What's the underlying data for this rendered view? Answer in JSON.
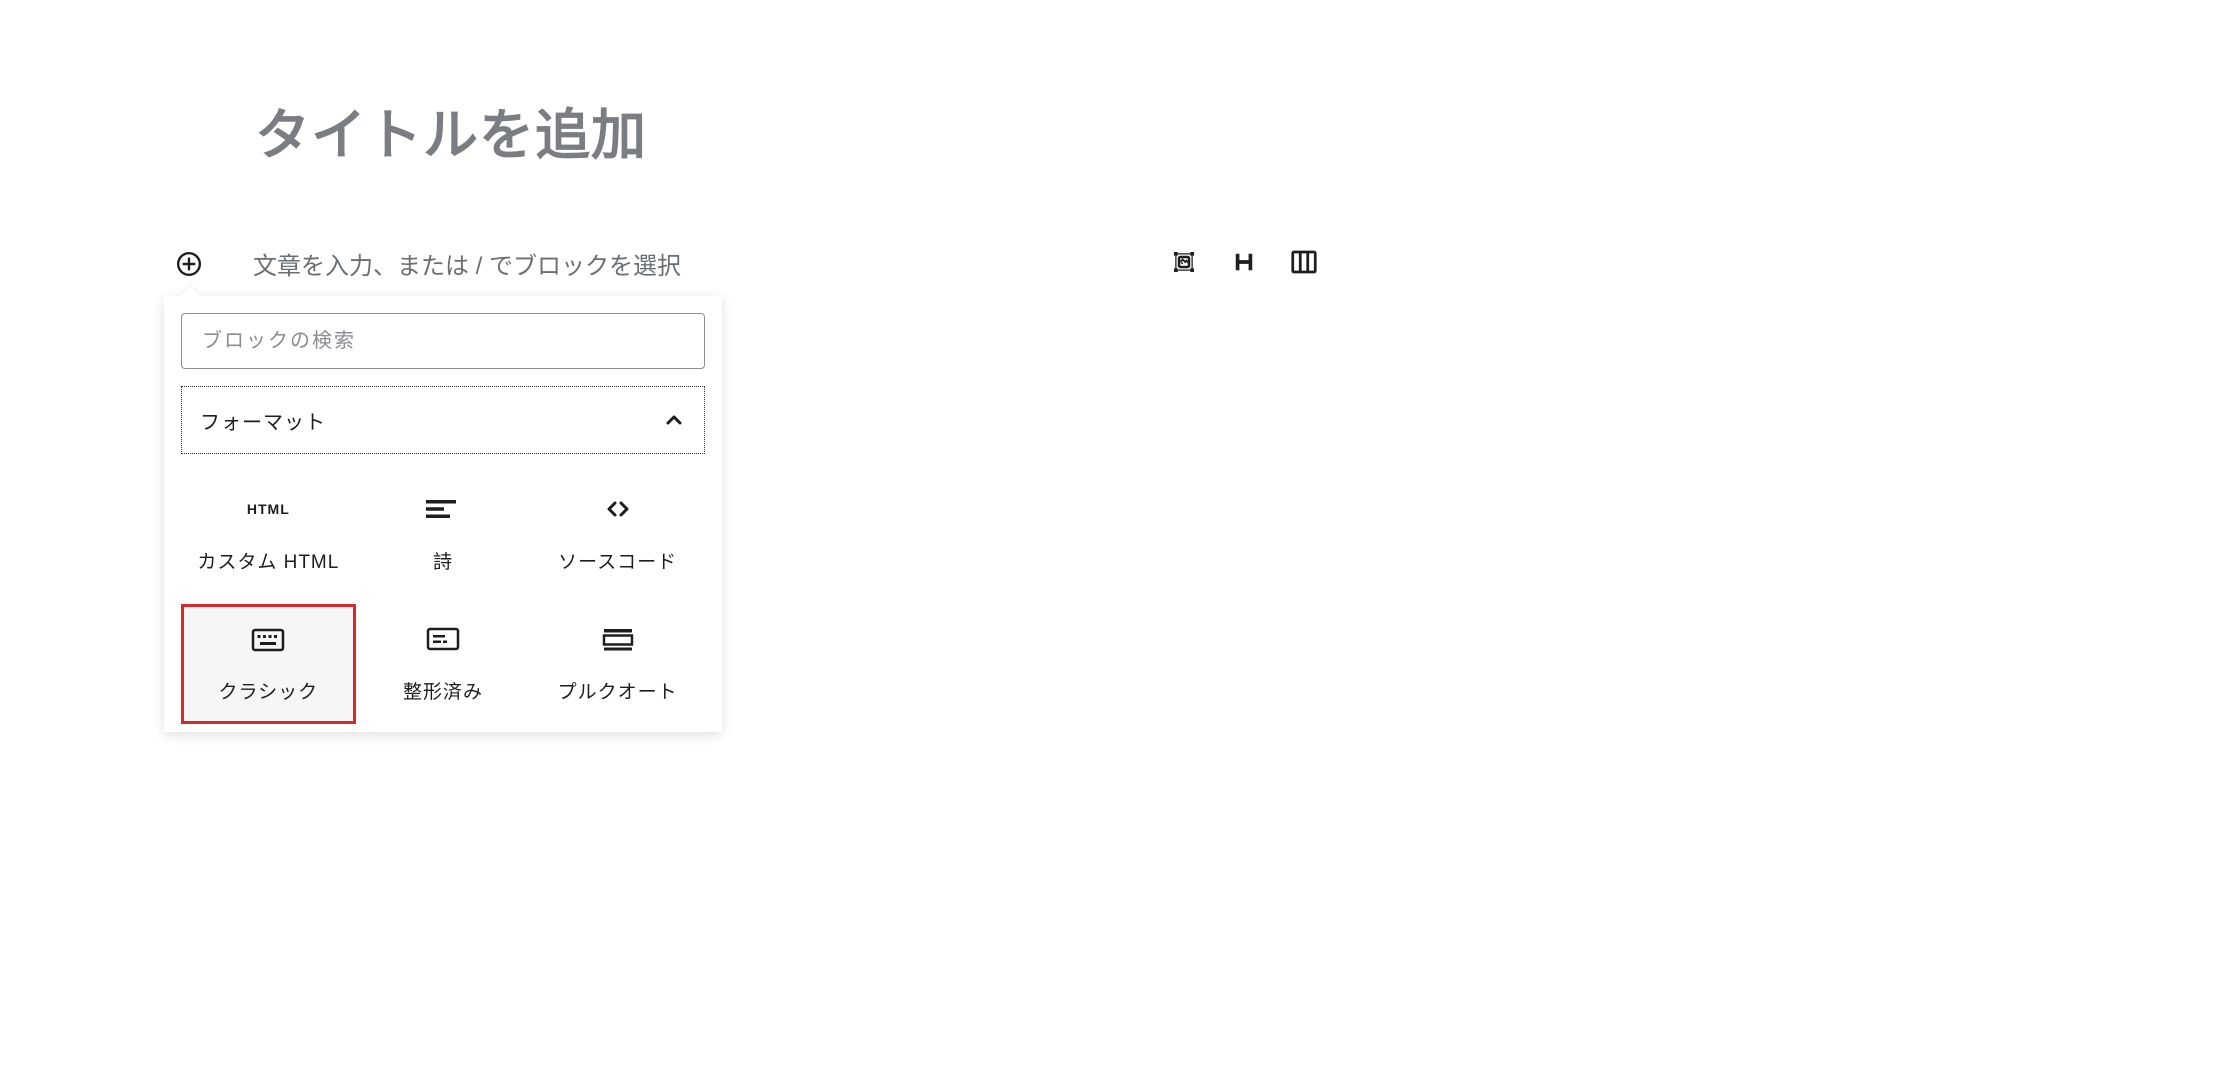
{
  "editor": {
    "title_placeholder": "タイトルを追加",
    "body_placeholder": "文章を入力、または / でブロックを選択"
  },
  "inserter": {
    "search_placeholder": "ブロックの検索",
    "category_label": "フォーマット",
    "blocks": {
      "custom_html": {
        "label": "カスタム HTML",
        "icon_text": "HTML"
      },
      "verse": {
        "label": "詩"
      },
      "code": {
        "label": "ソースコード"
      },
      "classic": {
        "label": "クラシック"
      },
      "preformatted": {
        "label": "整形済み"
      },
      "pullquote": {
        "label": "プルクオート"
      }
    }
  }
}
